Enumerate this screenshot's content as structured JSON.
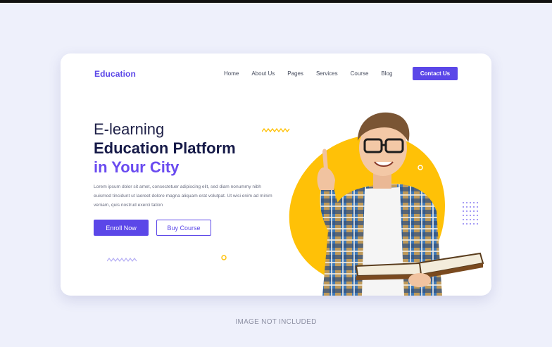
{
  "header": {
    "brand": "Education",
    "nav": [
      "Home",
      "About Us",
      "Pages",
      "Services",
      "Course",
      "Blog"
    ],
    "contact_label": "Contact Us"
  },
  "hero": {
    "line1": "E-learning",
    "line2": "Education Platform",
    "line3": "in Your City",
    "description": "Lorem ipsum dolor sit amet, consectetuer adipiscing elit, sed diam nonummy nibh euismod tincidunt ut laoreet dolore magna aliquam erat volutpat. Ut wisi enim ad minim veniam, quis nostrud exerci tation",
    "enroll_label": "Enroll Now",
    "buy_label": "Buy Course"
  },
  "caption": "IMAGE NOT INCLUDED",
  "colors": {
    "accent": "#5b47e8",
    "heading": "#161a48",
    "highlight": "#6a4bf0",
    "blob": "#ffc107",
    "background": "#eef0fb"
  },
  "icons": [
    "zigzag-decoration",
    "dot-grid-decoration",
    "circle-decoration",
    "yellow-blob"
  ]
}
